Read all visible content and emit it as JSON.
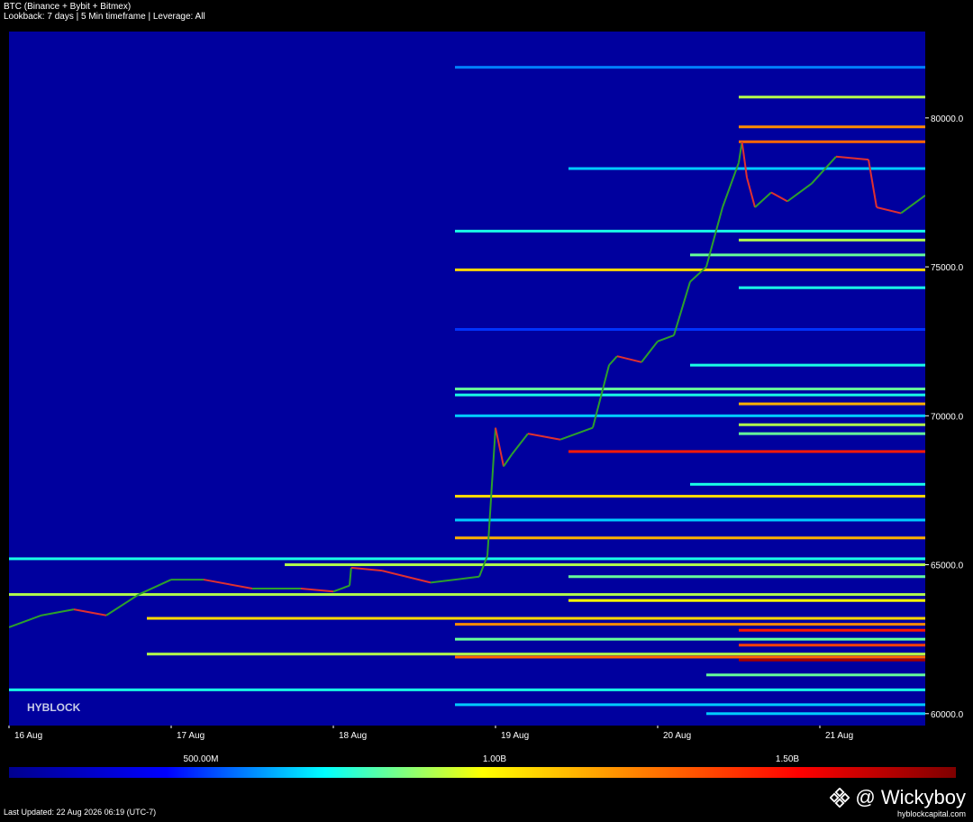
{
  "header": {
    "title": "BTC (Binance + Bybit + Bitmex)",
    "subtitle": "Lookback: 7 days | 5 Min timeframe | Leverage: All"
  },
  "watermark": "HYBLOCK",
  "footer": {
    "last_updated": "Last Updated: 22 Aug 2026 06:19 (UTC-7)"
  },
  "credit": {
    "handle": "@ Wickyboy",
    "site": "hyblockcapital.com"
  },
  "colorbar": {
    "labels": [
      "500.00M",
      "1.00B",
      "1.50B"
    ],
    "stops": [
      "#00008f",
      "#0000ff",
      "#00ffff",
      "#ffff00",
      "#ff7f00",
      "#ff0000",
      "#7f0000"
    ]
  },
  "colors": {
    "background": "#00009e",
    "candle_up": "#2ca02c",
    "candle_down": "#e03030"
  },
  "chart_data": {
    "type": "heatmap",
    "title": "BTC (Binance + Bybit + Bitmex)",
    "x_ticks": [
      "16 Aug",
      "17 Aug",
      "18 Aug",
      "19 Aug",
      "20 Aug",
      "21 Aug"
    ],
    "y_ticks": [
      "60000.0",
      "65000.0",
      "70000.0",
      "75000.0",
      "80000.0"
    ],
    "xlim": [
      0,
      5.65
    ],
    "ylim": [
      59600,
      82900
    ],
    "price_series": {
      "x": [
        0,
        0.2,
        0.4,
        0.6,
        0.8,
        1.0,
        1.2,
        1.5,
        1.8,
        2.0,
        2.1,
        2.11,
        2.3,
        2.6,
        2.9,
        2.95,
        3.0,
        3.05,
        3.1,
        3.2,
        3.4,
        3.6,
        3.7,
        3.75,
        3.9,
        4.0,
        4.1,
        4.2,
        4.3,
        4.4,
        4.5,
        4.52,
        4.55,
        4.6,
        4.7,
        4.8,
        4.95,
        5.1,
        5.3,
        5.35,
        5.5,
        5.65
      ],
      "y": [
        62900,
        63300,
        63500,
        63300,
        64000,
        64500,
        64500,
        64200,
        64200,
        64100,
        64300,
        64900,
        64800,
        64400,
        64600,
        65300,
        69600,
        68300,
        68700,
        69400,
        69200,
        69600,
        71700,
        72000,
        71800,
        72500,
        72700,
        74500,
        75000,
        77000,
        78500,
        79200,
        78000,
        77000,
        77500,
        77200,
        77800,
        78700,
        78600,
        77000,
        76800,
        77400
      ]
    },
    "liquidity_levels": [
      {
        "price": 81700,
        "start": 2.75,
        "intensity": 0.25
      },
      {
        "price": 80700,
        "start": 4.5,
        "intensity": 0.45
      },
      {
        "price": 79700,
        "start": 4.5,
        "intensity": 0.65
      },
      {
        "price": 79200,
        "start": 4.5,
        "intensity": 0.7
      },
      {
        "price": 78300,
        "start": 3.45,
        "intensity": 0.3
      },
      {
        "price": 76200,
        "start": 2.75,
        "intensity": 0.35
      },
      {
        "price": 75900,
        "start": 4.5,
        "intensity": 0.45
      },
      {
        "price": 75400,
        "start": 4.2,
        "intensity": 0.4
      },
      {
        "price": 74900,
        "start": 2.75,
        "intensity": 0.55
      },
      {
        "price": 74300,
        "start": 4.5,
        "intensity": 0.35
      },
      {
        "price": 72900,
        "start": 2.75,
        "intensity": 0.2
      },
      {
        "price": 71700,
        "start": 4.2,
        "intensity": 0.35
      },
      {
        "price": 70900,
        "start": 2.75,
        "intensity": 0.4
      },
      {
        "price": 70700,
        "start": 2.75,
        "intensity": 0.35
      },
      {
        "price": 70400,
        "start": 4.5,
        "intensity": 0.6
      },
      {
        "price": 70000,
        "start": 2.75,
        "intensity": 0.3
      },
      {
        "price": 69700,
        "start": 4.5,
        "intensity": 0.45
      },
      {
        "price": 69400,
        "start": 4.5,
        "intensity": 0.4
      },
      {
        "price": 68800,
        "start": 3.45,
        "intensity": 0.8
      },
      {
        "price": 67700,
        "start": 4.2,
        "intensity": 0.35
      },
      {
        "price": 67300,
        "start": 2.75,
        "intensity": 0.55
      },
      {
        "price": 66500,
        "start": 2.75,
        "intensity": 0.3
      },
      {
        "price": 65900,
        "start": 2.75,
        "intensity": 0.6
      },
      {
        "price": 65200,
        "start": 0,
        "intensity": 0.35
      },
      {
        "price": 65000,
        "start": 1.7,
        "intensity": 0.45
      },
      {
        "price": 64600,
        "start": 3.45,
        "intensity": 0.4
      },
      {
        "price": 64000,
        "start": 0,
        "intensity": 0.45
      },
      {
        "price": 63800,
        "start": 3.45,
        "intensity": 0.5
      },
      {
        "price": 63200,
        "start": 0.85,
        "intensity": 0.55
      },
      {
        "price": 63000,
        "start": 2.75,
        "intensity": 0.65
      },
      {
        "price": 62800,
        "start": 4.5,
        "intensity": 0.8
      },
      {
        "price": 62500,
        "start": 2.75,
        "intensity": 0.4
      },
      {
        "price": 62300,
        "start": 4.5,
        "intensity": 0.75
      },
      {
        "price": 62000,
        "start": 0.85,
        "intensity": 0.45
      },
      {
        "price": 61900,
        "start": 2.75,
        "intensity": 0.7
      },
      {
        "price": 61800,
        "start": 4.5,
        "intensity": 0.95
      },
      {
        "price": 61300,
        "start": 4.3,
        "intensity": 0.4
      },
      {
        "price": 60800,
        "start": 0,
        "intensity": 0.35
      },
      {
        "price": 60300,
        "start": 2.75,
        "intensity": 0.3
      },
      {
        "price": 60000,
        "start": 4.3,
        "intensity": 0.3
      }
    ]
  }
}
